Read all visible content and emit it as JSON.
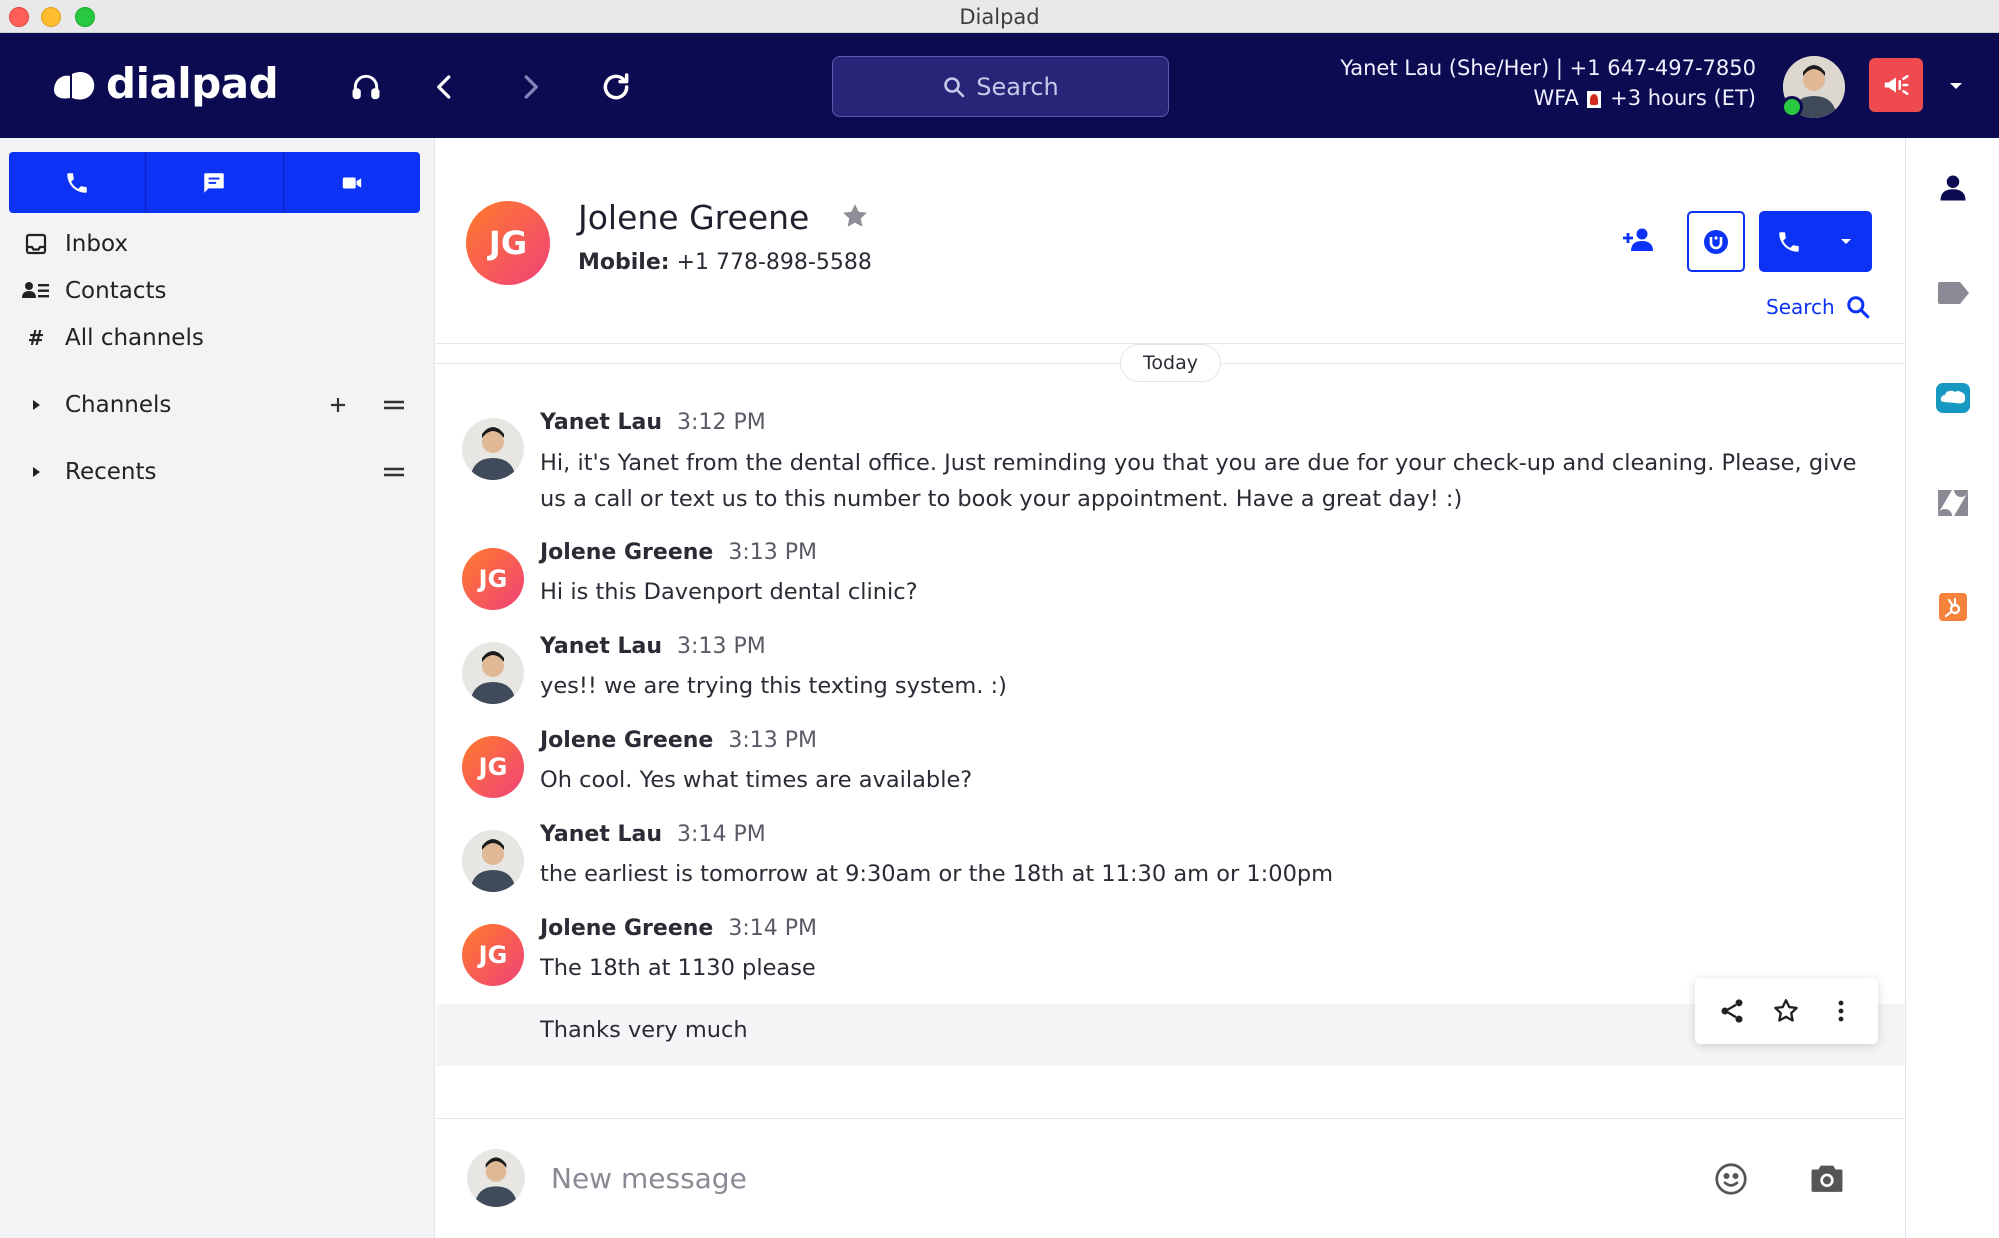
{
  "window": {
    "title": "Dialpad"
  },
  "nav": {
    "logo_text": "dialpad",
    "search_placeholder": "Search",
    "user_line1": "Yanet Lau (She/Her) | +1 647-497-7850",
    "user_line2_prefix": "WFA",
    "user_line2_suffix": "+3 hours (ET)"
  },
  "sidebar": {
    "items": [
      {
        "label": "Inbox",
        "icon": "inbox-icon"
      },
      {
        "label": "Contacts",
        "icon": "contacts-icon"
      },
      {
        "label": "All channels",
        "icon": "hash-icon"
      }
    ],
    "sections": [
      {
        "label": "Channels"
      },
      {
        "label": "Recents"
      }
    ]
  },
  "contact": {
    "initials": "JG",
    "name": "Jolene Greene",
    "mobile_label": "Mobile:",
    "mobile_number": "+1 778-898-5588",
    "search_label": "Search"
  },
  "thread": {
    "date_divider": "Today",
    "messages": [
      {
        "sender": "Yanet Lau",
        "time": "3:12 PM",
        "avatar": "photo",
        "text": "Hi, it's Yanet from the dental office. Just reminding you that you are due for your check-up and cleaning. Please, give us a call or text us to this number to book your appointment. Have a great day! :)"
      },
      {
        "sender": "Jolene Greene",
        "time": "3:13 PM",
        "avatar": "JG",
        "text": "Hi is this Davenport dental clinic?"
      },
      {
        "sender": "Yanet Lau",
        "time": "3:13 PM",
        "avatar": "photo",
        "text": "yes!! we are trying this texting system. :)"
      },
      {
        "sender": "Jolene Greene",
        "time": "3:13 PM",
        "avatar": "JG",
        "text": "Oh cool. Yes what times are available?"
      },
      {
        "sender": "Yanet Lau",
        "time": "3:14 PM",
        "avatar": "photo",
        "text": "the earliest is tomorrow at 9:30am or the 18th at 11:30 am or 1:00pm"
      },
      {
        "sender": "Jolene Greene",
        "time": "3:14 PM",
        "avatar": "JG",
        "text": "The 18th at 1130 please"
      }
    ],
    "continued_message": "Thanks very much"
  },
  "composer": {
    "placeholder": "New message"
  },
  "colors": {
    "nav_bg": "#0c0a51",
    "accent": "#0c33f5",
    "alert": "#ef4a4f",
    "avatar_gradient_start": "#ff7b2a",
    "avatar_gradient_end": "#f0427a",
    "presence": "#28c840"
  },
  "right_rail": [
    "person-icon",
    "tag-icon",
    "salesforce-icon",
    "zendesk-icon",
    "hubspot-icon"
  ]
}
